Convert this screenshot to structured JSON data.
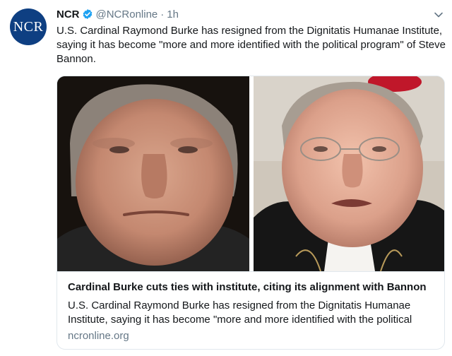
{
  "tweet": {
    "avatar_text": "NCR",
    "display_name": "NCR",
    "handle": "@NCRonline",
    "separator": "·",
    "time": "1h",
    "text": "U.S. Cardinal Raymond Burke has resigned from the Dignitatis Humanae Institute, saying it has become \"more and more identified with the political program\" of Steve Bannon.",
    "verified_icon": "verified-badge-icon",
    "menu_icon": "chevron-down-icon"
  },
  "card": {
    "title": "Cardinal Burke cuts ties with institute, citing its alignment with Bannon",
    "description": "U.S. Cardinal Raymond Burke has resigned from the Dignitatis Humanae Institute, saying it has become \"more and more identified with the political",
    "domain": "ncronline.org"
  },
  "colors": {
    "brand_avatar": "#0e3f82",
    "verified_blue": "#1da1f2",
    "secondary_text": "#657786",
    "border": "#e1e8ed"
  }
}
